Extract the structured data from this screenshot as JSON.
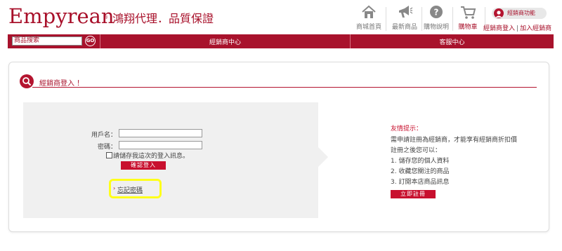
{
  "brand": {
    "logo_text": "Empyrean",
    "registered_mark": "®",
    "slogan": "鴻翔代理．品質保證"
  },
  "header_nav": [
    {
      "label": "商城首頁",
      "icon": "home-icon"
    },
    {
      "label": "最新商品",
      "icon": "megaphone-icon"
    },
    {
      "label": "購物說明",
      "icon": "question-icon"
    },
    {
      "label": "購物車",
      "icon": "cart-icon"
    }
  ],
  "dealer": {
    "menu_label": "經銷商功能",
    "login_link": "經銷商登入",
    "separator": "|",
    "join_link": "加入經銷商"
  },
  "search": {
    "value": "商品搜索",
    "go_label": "GO"
  },
  "top_tabs": [
    {
      "label": "經銷商中心"
    },
    {
      "label": "客服中心"
    }
  ],
  "login": {
    "section_title": "經銷商登入 ！",
    "username_label": "用戶名：",
    "username_value": "",
    "password_label": "密碼：",
    "password_value": "",
    "remember_label": "請儲存我這次的登入訊息。",
    "submit_label": "確認登入",
    "forgot_arrow": "›",
    "forgot_label": "忘記密碼"
  },
  "tips": {
    "title": "友情提示：",
    "lines": [
      "需申請註冊為經銷商，才能享有經銷商折扣價",
      "註冊之後您可以：",
      "1. 儲存您的個人資料",
      "2. 收藏您關注的商品",
      "3. 訂閱本店商品訊息"
    ],
    "register_label": "立即註冊"
  },
  "colors": {
    "brand_red": "#a8122c",
    "button_red": "#c8102e",
    "highlight": "#ffff1a",
    "panel_gray": "#f0f0f0"
  }
}
